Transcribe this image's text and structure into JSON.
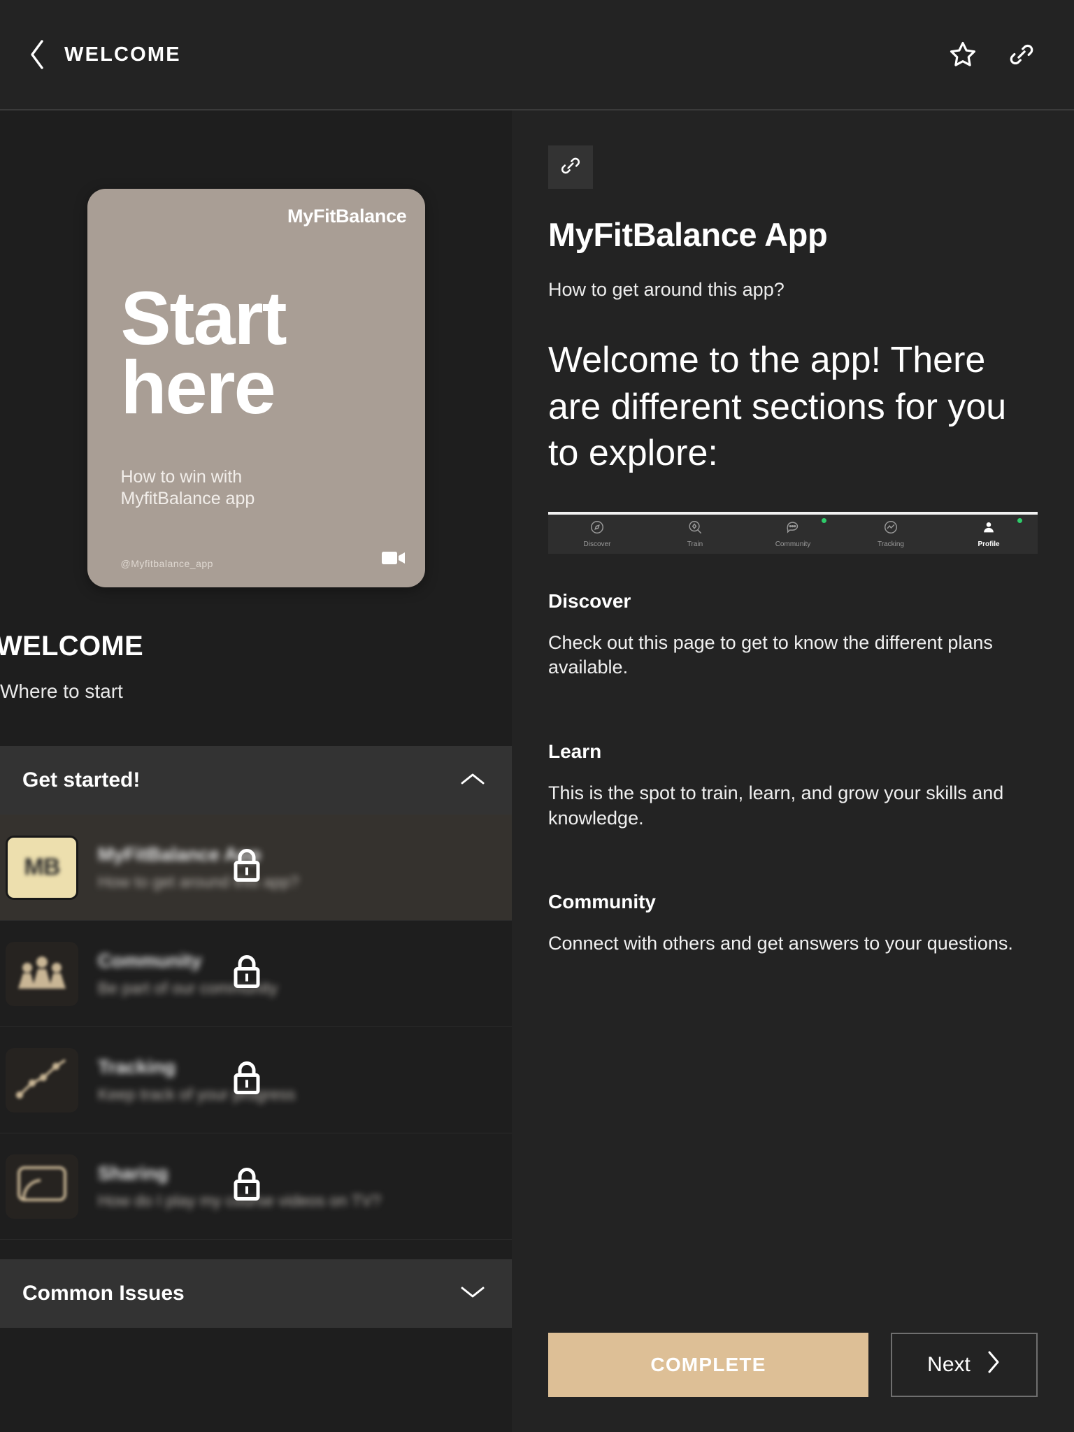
{
  "topbar": {
    "back_icon": "chevron-left-icon",
    "title": "WELCOME",
    "favorite_icon": "star-icon",
    "link_icon": "link-icon"
  },
  "left": {
    "hero": {
      "brand": "MyFitBalance",
      "headline_line1": "Start",
      "headline_line2": "here",
      "subtitle_line1": "How to win with",
      "subtitle_line2": "MyfitBalance app",
      "handle": "@Myfitbalance_app",
      "badge_icon": "video-camera-icon"
    },
    "section_title": "WELCOME",
    "section_subtitle": "Where to start",
    "accordions": [
      {
        "label": "Get started!",
        "expanded": true,
        "chevron_icon": "chevron-up-icon"
      },
      {
        "label": "Common Issues",
        "expanded": false,
        "chevron_icon": "chevron-down-icon"
      }
    ],
    "lessons": [
      {
        "name": "MyFitBalance App",
        "desc": "How to get around this app?",
        "thumb_text": "MB",
        "thumb_style": "cream",
        "locked": true,
        "lock_icon": "lock-icon",
        "active": true
      },
      {
        "name": "Community",
        "desc": "Be part of our community",
        "thumb_icon": "people-group-icon",
        "thumb_style": "plain",
        "locked": true,
        "lock_icon": "lock-icon",
        "active": false
      },
      {
        "name": "Tracking",
        "desc": "Keep track of your progress",
        "thumb_icon": "line-chart-icon",
        "thumb_style": "plain",
        "locked": true,
        "lock_icon": "lock-icon",
        "active": false
      },
      {
        "name": "Sharing",
        "desc": "How do I play my course videos on TV?",
        "thumb_icon": "tv-screen-icon",
        "thumb_style": "plain",
        "locked": true,
        "lock_icon": "lock-icon",
        "active": false
      }
    ]
  },
  "right": {
    "link_chip_icon": "link-icon",
    "title": "MyFitBalance App",
    "kicker": "How to get around this app?",
    "lede": "Welcome to the app! There are different sections for you to explore:",
    "navbar_screenshot": {
      "items": [
        {
          "label": "Discover",
          "icon": "compass-icon",
          "active": false,
          "dot": false
        },
        {
          "label": "Train",
          "icon": "target-search-icon",
          "active": false,
          "dot": false
        },
        {
          "label": "Community",
          "icon": "chat-bubble-icon",
          "active": false,
          "dot": true
        },
        {
          "label": "Tracking",
          "icon": "activity-circle-icon",
          "active": false,
          "dot": false
        },
        {
          "label": "Profile",
          "icon": "user-icon",
          "active": true,
          "dot": true
        }
      ],
      "dot_color": "#2ecc6a"
    },
    "sections": [
      {
        "heading": "Discover",
        "body": "Check out this page to get to know the different plans available."
      },
      {
        "heading": "Learn",
        "body": "This is the spot to train, learn, and grow your skills and knowledge."
      },
      {
        "heading": "Community",
        "body": "Connect with others and get answers to your questions."
      }
    ],
    "complete_label": "COMPLETE",
    "next_label": "Next",
    "next_icon": "chevron-right-icon",
    "accent_color": "#ddbf96"
  }
}
